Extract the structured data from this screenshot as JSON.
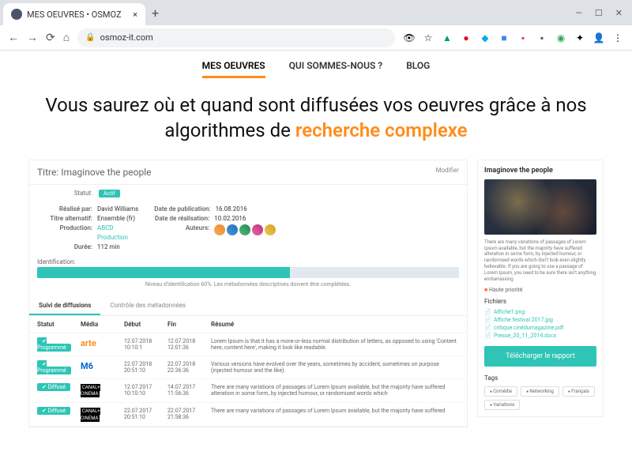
{
  "browser": {
    "tab_title": "MES OEUVRES • OSMOZ",
    "url": "osmoz-it.com"
  },
  "nav": {
    "mes_oeuvres": "MES OEUVRES",
    "qui_sommes": "QUI SOMMES-NOUS ?",
    "blog": "BLOG"
  },
  "hero": {
    "line": "Vous saurez où et quand sont diffusées vos oeuvres grâce à nos algorithmes de",
    "highlight": "recherche complexe"
  },
  "work": {
    "title_label": "Titre:",
    "title": "Imaginove the people",
    "modify": "Modifier",
    "statut_label": "Statut:",
    "statut_badge": "Actif",
    "meta_left": [
      {
        "k": "Réalisé par:",
        "v": "David Williams"
      },
      {
        "k": "Titre alternatif:",
        "v": "Ensemble (fr)"
      },
      {
        "k": "Production:",
        "v": "ABCD",
        "link": true
      },
      {
        "k": "",
        "v": "Production",
        "link": true
      },
      {
        "k": "Durée:",
        "v": "112 min"
      }
    ],
    "meta_right": [
      {
        "k": "Date de publication:",
        "v": "16.08.2016"
      },
      {
        "k": "Date de réalisation:",
        "v": "10.02.2016"
      },
      {
        "k": "Auteurs:",
        "v": ""
      }
    ],
    "ident_label": "Identification:",
    "ident_hint": "Niveau d'identification 60%. Les métadonnées descriptives doivent être complétées.",
    "tabs": {
      "suivi": "Suivi de diffusions",
      "controle": "Contrôle des métadonnées"
    },
    "thead": {
      "statut": "Statut",
      "media": "Média",
      "debut": "Début",
      "fin": "Fin",
      "resume": "Résumé"
    },
    "rows": [
      {
        "statut": "✔ Programmé",
        "media": "arte",
        "d1": "12.07.2018",
        "d2": "10:10:1",
        "f1": "12.07.2018",
        "f2": "12:01:36",
        "resume": "Lorem Ipsum is that it has a more-or-less normal distribution of letters, as opposed to using 'Content here, content here', making it look like readable."
      },
      {
        "statut": "✔ Programmé",
        "media": "m6",
        "d1": "22.07.2018",
        "d2": "20:51:10",
        "f1": "22.07.2018",
        "f2": "22:36:36",
        "resume": "Various versions have evolved over the years, sometimes by accident, sometimes on purpose (injected humour and the like)."
      },
      {
        "statut": "✔ Diffusé",
        "media": "canal",
        "d1": "12.07.2017",
        "d2": "10:10:10",
        "f1": "14.07.2017",
        "f2": "11:56:36",
        "resume": "There are many variations of passages of Lorem Ipsum available, but the majority have suffered alteration in some form, by injected humour, or randomised words which"
      },
      {
        "statut": "✔ Diffusé",
        "media": "canal",
        "d1": "22.07.2017",
        "d2": "20:51:10",
        "f1": "22.07.2017",
        "f2": "21:58:36",
        "resume": "There are many variations of passages of Lorem Ipsum available, but the majority have suffered"
      }
    ]
  },
  "side": {
    "title": "Imaginove the people",
    "desc": "There are many variations of passages of Lorem Ipsum available, but the majority have suffered alteration in some form, by injected humour, or randomised words which don't look even slightly believable. If you are going to use a passage of Lorem Ipsum, you need to be sure there isn't anything embarrassing",
    "priority": "Haute priorité",
    "fichiers_label": "Fichiers",
    "files": [
      "Affiche1.png",
      "Affiche festival 2017.jpg",
      "critique cinédumagazine.pdf",
      "Presse_20_11_2014.docx"
    ],
    "download": "Télécharger le rapport",
    "tags_label": "Tags",
    "tags": [
      "Comédie",
      "Networking",
      "Français",
      "Variations"
    ]
  }
}
